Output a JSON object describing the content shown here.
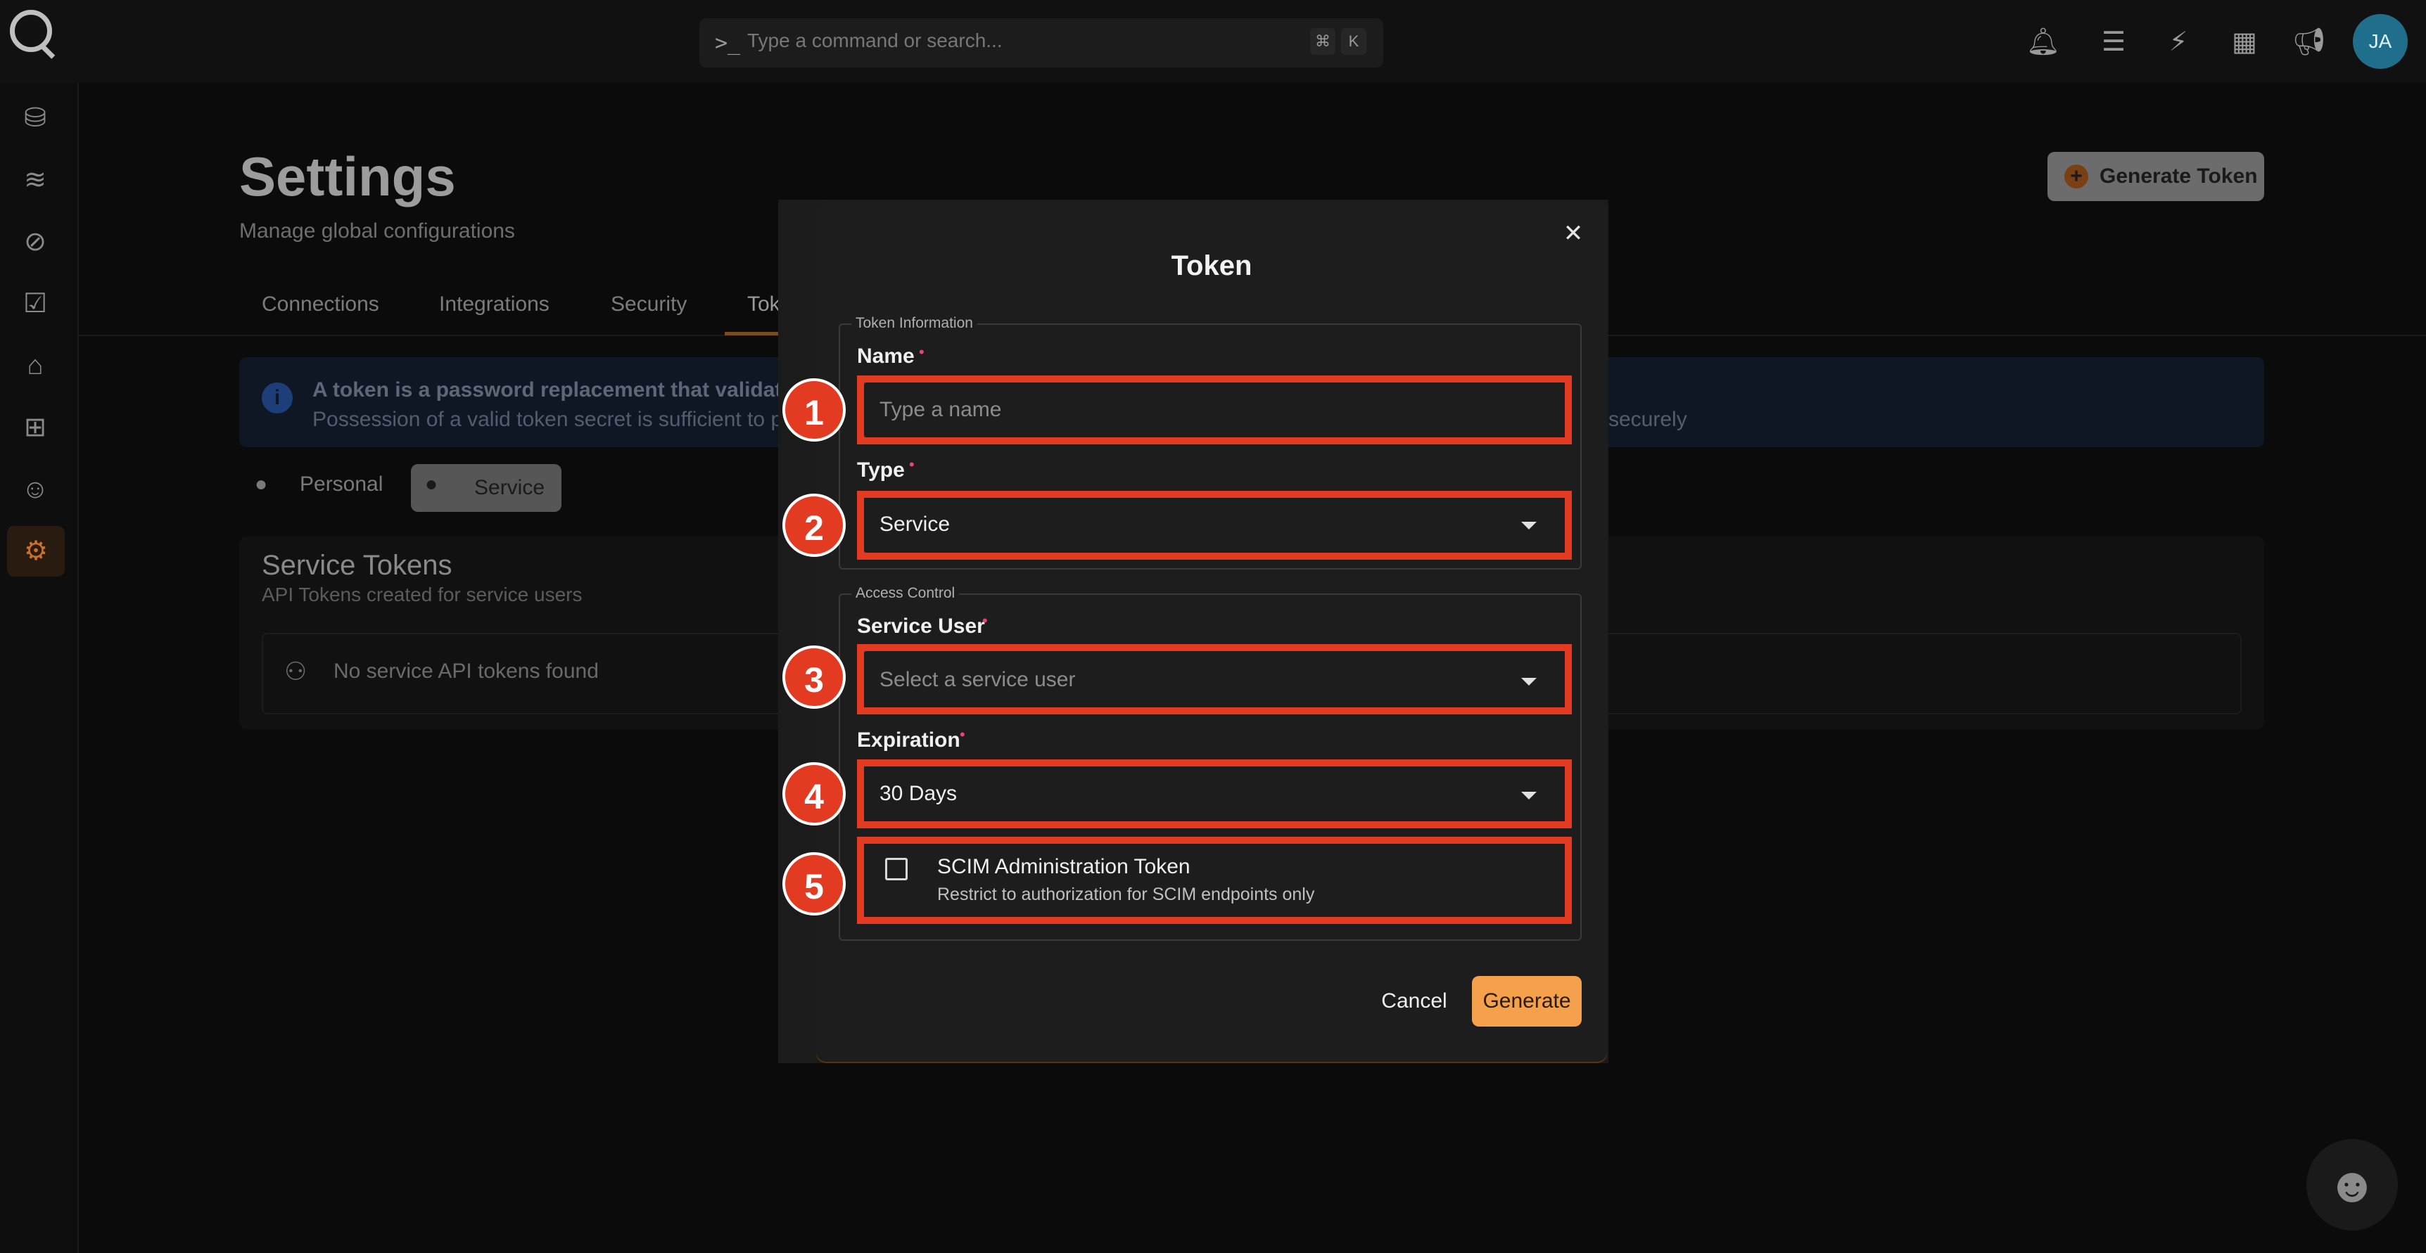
{
  "topbar": {
    "command_prompt": ">_",
    "search_placeholder": "Type a command or search...",
    "shortcut_keys": [
      "⌘",
      "K"
    ],
    "icons": [
      "bell-icon",
      "document-icon",
      "magic-wand-icon",
      "apps-grid-icon",
      "megaphone-icon"
    ],
    "avatar_initials": "JA"
  },
  "sidebar": {
    "icons": [
      "database-icon",
      "data-stack-icon",
      "compass-icon",
      "clipboard-check-icon",
      "tag-icon",
      "hierarchy-icon",
      "robot-icon",
      "gear-icon"
    ],
    "active": "gear-icon"
  },
  "page": {
    "title": "Settings",
    "subtitle": "Manage global configurations",
    "generate_button": "Generate Token",
    "tabs": [
      "Connections",
      "Integrations",
      "Security",
      "Tokens"
    ],
    "active_tab": "Tokens",
    "banner_line1": "A token is a password replacement that validates y",
    "banner_line2": "Possession of a valid token secret is sufficient to per",
    "banner_line2_end": "securely",
    "toggle": {
      "personal": "Personal",
      "service": "Service",
      "active": "Service"
    },
    "card_title": "Service Tokens",
    "card_subtitle": "API Tokens created for service users",
    "empty_text": "No service API tokens found"
  },
  "modal": {
    "title": "Token",
    "token_info_legend": "Token Information",
    "name_label": "Name",
    "name_placeholder": "Type a name",
    "type_label": "Type",
    "type_value": "Service",
    "access_legend": "Access Control",
    "service_user_label": "Service User",
    "service_user_placeholder": "Select a service user",
    "expiration_label": "Expiration",
    "expiration_value": "30 Days",
    "scim_title": "SCIM Administration Token",
    "scim_subtitle": "Restrict to authorization for SCIM endpoints only",
    "scim_checked": false,
    "required_marker": "•",
    "cancel_label": "Cancel",
    "generate_label": "Generate"
  },
  "annotations": [
    "1",
    "2",
    "3",
    "4",
    "5"
  ],
  "colors": {
    "highlight": "#e33b22",
    "primary_button": "#f5a04a",
    "required": "#e8437b",
    "avatar": "#1f6f8c"
  }
}
